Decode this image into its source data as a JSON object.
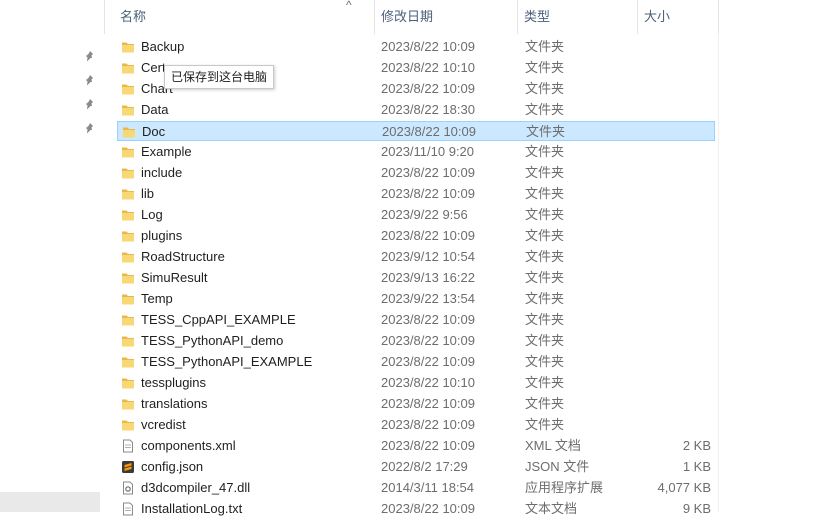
{
  "header": {
    "name": "名称",
    "date": "修改日期",
    "type": "类型",
    "size": "大小",
    "sort_arrow": "^"
  },
  "tooltip": "已保存到这台电脑",
  "files": [
    {
      "name": "Backup",
      "date": "2023/8/22 10:09",
      "type": "文件夹",
      "size": "",
      "icon": "folder-icon"
    },
    {
      "name": "Cert",
      "date": "2023/8/22 10:10",
      "type": "文件夹",
      "size": "",
      "icon": "folder-icon"
    },
    {
      "name": "Chart",
      "date": "2023/8/22 10:09",
      "type": "文件夹",
      "size": "",
      "icon": "folder-icon"
    },
    {
      "name": "Data",
      "date": "2023/8/22 18:30",
      "type": "文件夹",
      "size": "",
      "icon": "folder-icon"
    },
    {
      "name": "Doc",
      "date": "2023/8/22 10:09",
      "type": "文件夹",
      "size": "",
      "icon": "folder-icon",
      "selected": true
    },
    {
      "name": "Example",
      "date": "2023/11/10 9:20",
      "type": "文件夹",
      "size": "",
      "icon": "folder-icon"
    },
    {
      "name": "include",
      "date": "2023/8/22 10:09",
      "type": "文件夹",
      "size": "",
      "icon": "folder-icon"
    },
    {
      "name": "lib",
      "date": "2023/8/22 10:09",
      "type": "文件夹",
      "size": "",
      "icon": "folder-icon"
    },
    {
      "name": "Log",
      "date": "2023/9/22 9:56",
      "type": "文件夹",
      "size": "",
      "icon": "folder-icon"
    },
    {
      "name": "plugins",
      "date": "2023/8/22 10:09",
      "type": "文件夹",
      "size": "",
      "icon": "folder-icon"
    },
    {
      "name": "RoadStructure",
      "date": "2023/9/12 10:54",
      "type": "文件夹",
      "size": "",
      "icon": "folder-icon"
    },
    {
      "name": "SimuResult",
      "date": "2023/9/13 16:22",
      "type": "文件夹",
      "size": "",
      "icon": "folder-icon"
    },
    {
      "name": "Temp",
      "date": "2023/9/22 13:54",
      "type": "文件夹",
      "size": "",
      "icon": "folder-icon"
    },
    {
      "name": "TESS_CppAPI_EXAMPLE",
      "date": "2023/8/22 10:09",
      "type": "文件夹",
      "size": "",
      "icon": "folder-icon"
    },
    {
      "name": "TESS_PythonAPI_demo",
      "date": "2023/8/22 10:09",
      "type": "文件夹",
      "size": "",
      "icon": "folder-icon"
    },
    {
      "name": "TESS_PythonAPI_EXAMPLE",
      "date": "2023/8/22 10:09",
      "type": "文件夹",
      "size": "",
      "icon": "folder-icon"
    },
    {
      "name": "tessplugins",
      "date": "2023/8/22 10:10",
      "type": "文件夹",
      "size": "",
      "icon": "folder-icon"
    },
    {
      "name": "translations",
      "date": "2023/8/22 10:09",
      "type": "文件夹",
      "size": "",
      "icon": "folder-icon"
    },
    {
      "name": "vcredist",
      "date": "2023/8/22 10:09",
      "type": "文件夹",
      "size": "",
      "icon": "folder-icon"
    },
    {
      "name": "components.xml",
      "date": "2023/8/22 10:09",
      "type": "XML 文档",
      "size": "2 KB",
      "icon": "document-icon"
    },
    {
      "name": "config.json",
      "date": "2022/8/2 17:29",
      "type": "JSON 文件",
      "size": "1 KB",
      "icon": "sublime-file-icon"
    },
    {
      "name": "d3dcompiler_47.dll",
      "date": "2014/3/11 18:54",
      "type": "应用程序扩展",
      "size": "4,077 KB",
      "icon": "dll-file-icon"
    },
    {
      "name": "InstallationLog.txt",
      "date": "2023/8/22 10:09",
      "type": "文本文档",
      "size": "9 KB",
      "icon": "text-file-icon"
    }
  ],
  "colors": {
    "folder": "#f8d775",
    "folder_dark": "#e8b94a",
    "selection": "#cce8ff",
    "selection_border": "#99d1ff",
    "header_text": "#4c607a"
  }
}
